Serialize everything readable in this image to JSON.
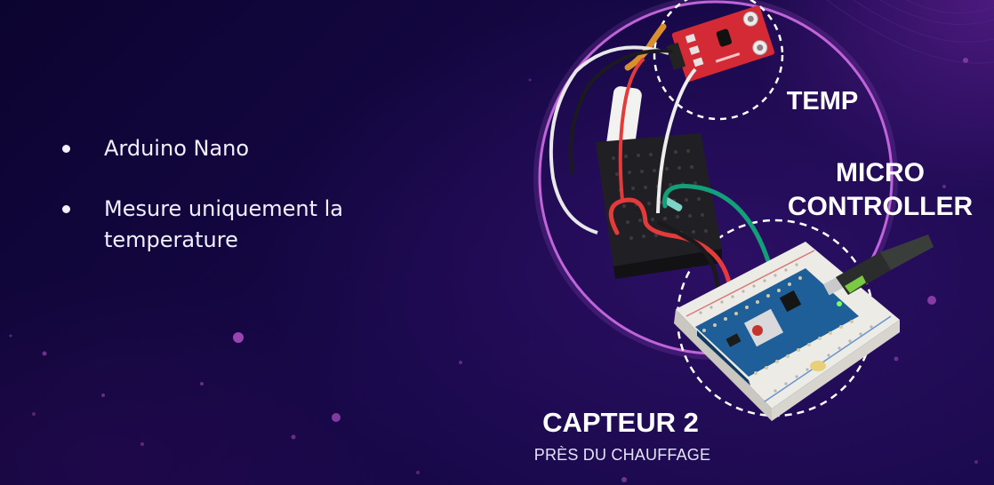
{
  "bullets": [
    {
      "text": "Arduino Nano"
    },
    {
      "text": "Mesure uniquement la temperature"
    }
  ],
  "labels": {
    "temp": "TEMP",
    "micro_line1": "MICRO",
    "micro_line2": "CONTROLLER",
    "capteur": "CAPTEUR 2",
    "capteur_sub": "PRÈS DU CHAUFFAGE"
  },
  "colors": {
    "background": "#12063a",
    "ring": "#d16ee8",
    "dashed": "#ffffff",
    "sensor_board": "#d42a36",
    "breadboard_black": "#202024",
    "breadboard_white": "#ecebe6",
    "arduino": "#1e5f99",
    "wire_red": "#e33b3b",
    "wire_green": "#12a07a"
  },
  "icons": [
    "bullet-dot",
    "temperature-sensor-module",
    "mini-breadboard",
    "arduino-nano-board",
    "usb-cable"
  ]
}
